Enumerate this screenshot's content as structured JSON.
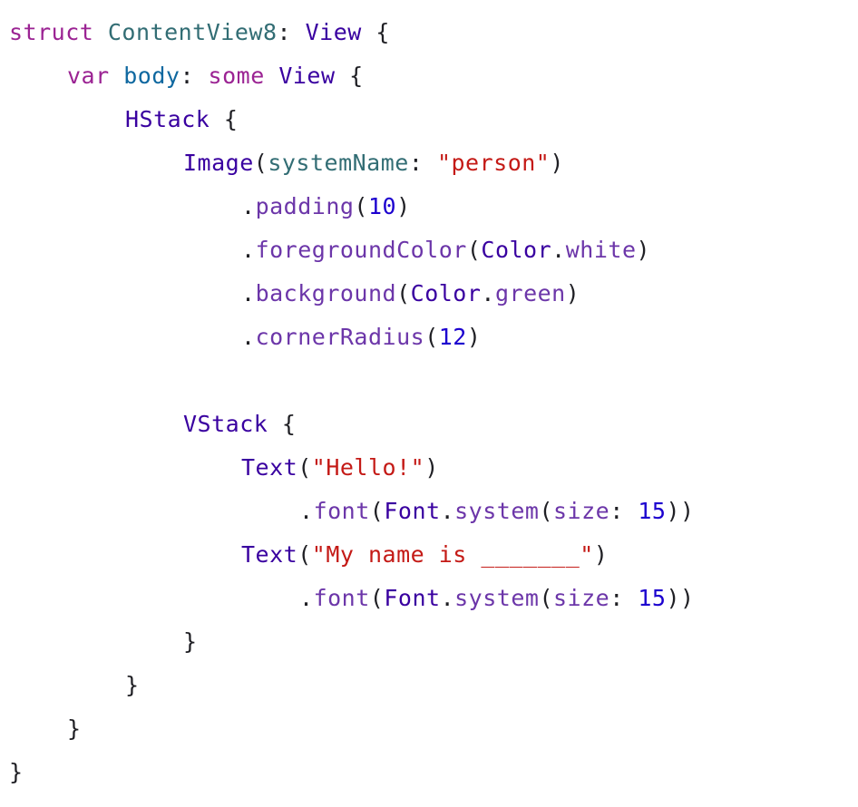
{
  "editor": {
    "colors": {
      "keyword": "#9b2393",
      "type": "#3900a0",
      "declaration": "#0f68a0",
      "project": "#326d74",
      "method": "#6c36a9",
      "string": "#c41a16",
      "number": "#1c00cf",
      "plain": "#1f1f24"
    },
    "lines": [
      {
        "indent": 0,
        "tokens": [
          {
            "t": "struct",
            "k": "keyword"
          },
          {
            "t": " ",
            "k": "plain"
          },
          {
            "t": "ContentView8",
            "k": "project"
          },
          {
            "t": ": ",
            "k": "plain"
          },
          {
            "t": "View",
            "k": "type"
          },
          {
            "t": " {",
            "k": "plain"
          }
        ]
      },
      {
        "indent": 4,
        "tokens": [
          {
            "t": "var",
            "k": "keyword"
          },
          {
            "t": " ",
            "k": "plain"
          },
          {
            "t": "body",
            "k": "declaration"
          },
          {
            "t": ": ",
            "k": "plain"
          },
          {
            "t": "some",
            "k": "keyword"
          },
          {
            "t": " ",
            "k": "plain"
          },
          {
            "t": "View",
            "k": "type"
          },
          {
            "t": " {",
            "k": "plain"
          }
        ]
      },
      {
        "indent": 8,
        "tokens": [
          {
            "t": "HStack",
            "k": "type"
          },
          {
            "t": " {",
            "k": "plain"
          }
        ]
      },
      {
        "indent": 12,
        "tokens": [
          {
            "t": "Image",
            "k": "type"
          },
          {
            "t": "(",
            "k": "plain"
          },
          {
            "t": "systemName",
            "k": "project"
          },
          {
            "t": ": ",
            "k": "plain"
          },
          {
            "t": "\"person\"",
            "k": "string"
          },
          {
            "t": ")",
            "k": "plain"
          }
        ]
      },
      {
        "indent": 16,
        "tokens": [
          {
            "t": ".",
            "k": "plain"
          },
          {
            "t": "padding",
            "k": "method"
          },
          {
            "t": "(",
            "k": "plain"
          },
          {
            "t": "10",
            "k": "number"
          },
          {
            "t": ")",
            "k": "plain"
          }
        ]
      },
      {
        "indent": 16,
        "tokens": [
          {
            "t": ".",
            "k": "plain"
          },
          {
            "t": "foregroundColor",
            "k": "method"
          },
          {
            "t": "(",
            "k": "plain"
          },
          {
            "t": "Color",
            "k": "type"
          },
          {
            "t": ".",
            "k": "plain"
          },
          {
            "t": "white",
            "k": "method"
          },
          {
            "t": ")",
            "k": "plain"
          }
        ]
      },
      {
        "indent": 16,
        "tokens": [
          {
            "t": ".",
            "k": "plain"
          },
          {
            "t": "background",
            "k": "method"
          },
          {
            "t": "(",
            "k": "plain"
          },
          {
            "t": "Color",
            "k": "type"
          },
          {
            "t": ".",
            "k": "plain"
          },
          {
            "t": "green",
            "k": "method"
          },
          {
            "t": ")",
            "k": "plain"
          }
        ]
      },
      {
        "indent": 16,
        "tokens": [
          {
            "t": ".",
            "k": "plain"
          },
          {
            "t": "cornerRadius",
            "k": "method"
          },
          {
            "t": "(",
            "k": "plain"
          },
          {
            "t": "12",
            "k": "number"
          },
          {
            "t": ")",
            "k": "plain"
          }
        ]
      },
      {
        "indent": 0,
        "tokens": []
      },
      {
        "indent": 12,
        "tokens": [
          {
            "t": "VStack",
            "k": "type"
          },
          {
            "t": " {",
            "k": "plain"
          }
        ]
      },
      {
        "indent": 16,
        "tokens": [
          {
            "t": "Text",
            "k": "type"
          },
          {
            "t": "(",
            "k": "plain"
          },
          {
            "t": "\"Hello!\"",
            "k": "string"
          },
          {
            "t": ")",
            "k": "plain"
          }
        ]
      },
      {
        "indent": 20,
        "tokens": [
          {
            "t": ".",
            "k": "plain"
          },
          {
            "t": "font",
            "k": "method"
          },
          {
            "t": "(",
            "k": "plain"
          },
          {
            "t": "Font",
            "k": "type"
          },
          {
            "t": ".",
            "k": "plain"
          },
          {
            "t": "system",
            "k": "method"
          },
          {
            "t": "(",
            "k": "plain"
          },
          {
            "t": "size",
            "k": "method"
          },
          {
            "t": ": ",
            "k": "plain"
          },
          {
            "t": "15",
            "k": "number"
          },
          {
            "t": "))",
            "k": "plain"
          }
        ]
      },
      {
        "indent": 16,
        "tokens": [
          {
            "t": "Text",
            "k": "type"
          },
          {
            "t": "(",
            "k": "plain"
          },
          {
            "t": "\"My name is _______\"",
            "k": "string"
          },
          {
            "t": ")",
            "k": "plain"
          }
        ]
      },
      {
        "indent": 20,
        "tokens": [
          {
            "t": ".",
            "k": "plain"
          },
          {
            "t": "font",
            "k": "method"
          },
          {
            "t": "(",
            "k": "plain"
          },
          {
            "t": "Font",
            "k": "type"
          },
          {
            "t": ".",
            "k": "plain"
          },
          {
            "t": "system",
            "k": "method"
          },
          {
            "t": "(",
            "k": "plain"
          },
          {
            "t": "size",
            "k": "method"
          },
          {
            "t": ": ",
            "k": "plain"
          },
          {
            "t": "15",
            "k": "number"
          },
          {
            "t": "))",
            "k": "plain"
          }
        ]
      },
      {
        "indent": 12,
        "tokens": [
          {
            "t": "}",
            "k": "plain"
          }
        ]
      },
      {
        "indent": 8,
        "tokens": [
          {
            "t": "}",
            "k": "plain"
          }
        ]
      },
      {
        "indent": 4,
        "tokens": [
          {
            "t": "}",
            "k": "plain"
          }
        ]
      },
      {
        "indent": 0,
        "tokens": [
          {
            "t": "}",
            "k": "plain"
          }
        ]
      }
    ]
  }
}
